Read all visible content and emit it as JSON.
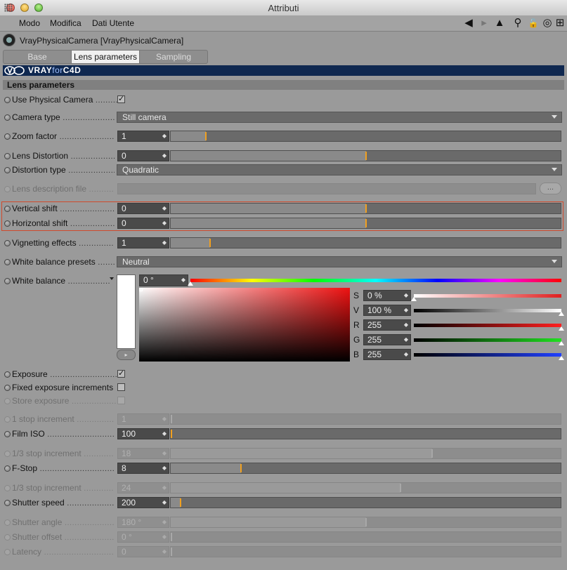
{
  "window": {
    "title": "Attributi"
  },
  "menu": {
    "items": [
      "Modo",
      "Modifica",
      "Dati Utente"
    ]
  },
  "toolbar": {
    "icons": [
      "arrow-left-icon",
      "arrow-right-icon",
      "arrow-up-icon",
      "search-icon",
      "lock-icon",
      "target-icon",
      "add-icon"
    ],
    "glyphs": [
      "◀",
      "▸",
      "▲",
      "⚲",
      "🔓",
      "◎",
      "⊞"
    ]
  },
  "object": {
    "title": "VrayPhysicalCamera [VrayPhysicalCamera]"
  },
  "tabs": [
    {
      "label": "Base",
      "active": false
    },
    {
      "label": "Lens parameters",
      "active": true
    },
    {
      "label": "Sampling",
      "active": false
    }
  ],
  "banner": {
    "brand": "VRAY",
    "brand_for": "for",
    "brand_c4d": "C4D"
  },
  "section": {
    "title": "Lens parameters"
  },
  "rows": {
    "use_physical_camera": {
      "label": "Use Physical Camera",
      "checked": true
    },
    "camera_type": {
      "label": "Camera type",
      "value": "Still camera"
    },
    "zoom_factor": {
      "label": "Zoom factor",
      "value": "1",
      "level": 0.09
    },
    "lens_distortion": {
      "label": "Lens Distortion",
      "value": "0",
      "level": 0.5
    },
    "distortion_type": {
      "label": "Distortion type",
      "value": "Quadratic"
    },
    "lens_description_file": {
      "label": "Lens description file",
      "button": "..."
    },
    "vertical_shift": {
      "label": "Vertical shift",
      "value": "0",
      "level": 0.5
    },
    "horizontal_shift": {
      "label": "Horizontal shift",
      "value": "0",
      "level": 0.5
    },
    "vignetting_effects": {
      "label": "Vignetting effects",
      "value": "1",
      "level": 0.1
    },
    "white_balance_presets": {
      "label": "White balance presets",
      "value": "Neutral"
    },
    "white_balance": {
      "label": "White balance"
    },
    "exposure": {
      "label": "Exposure",
      "checked": true
    },
    "fixed_exposure_increments": {
      "label": "Fixed exposure increments",
      "checked": false
    },
    "store_exposure": {
      "label": "Store exposure",
      "checked": false
    },
    "stop_increment_1": {
      "label": "1 stop increment",
      "value": "1",
      "level": 0.0
    },
    "film_iso": {
      "label": "Film ISO",
      "value": "100",
      "level": 0.0
    },
    "third_stop_increment_a": {
      "label": "1/3 stop increment",
      "value": "18",
      "level": 0.67
    },
    "f_stop": {
      "label": "F-Stop",
      "value": "8",
      "level": 0.18
    },
    "third_stop_increment_b": {
      "label": "1/3 stop increment",
      "value": "24",
      "level": 0.59
    },
    "shutter_speed": {
      "label": "Shutter speed",
      "value": "200",
      "level": 0.025
    },
    "shutter_angle": {
      "label": "Shutter angle",
      "value": "180 °",
      "level": 0.5
    },
    "shutter_offset": {
      "label": "Shutter offset",
      "value": "0 °",
      "level": 0.0
    },
    "latency": {
      "label": "Latency",
      "value": "0",
      "level": 0.0
    }
  },
  "color": {
    "hue_value": "0 °",
    "hue_level": 0.0,
    "channels": [
      {
        "key": "S",
        "value": "0 %",
        "level": 0.0,
        "from": "#ffffff",
        "to": "#e02020"
      },
      {
        "key": "V",
        "value": "100 %",
        "level": 1.0,
        "from": "#000000",
        "to": "#ffffff"
      },
      {
        "key": "R",
        "value": "255",
        "level": 1.0,
        "from": "#000000",
        "to": "#ff2020"
      },
      {
        "key": "G",
        "value": "255",
        "level": 1.0,
        "from": "#000000",
        "to": "#20e020"
      },
      {
        "key": "B",
        "value": "255",
        "level": 1.0,
        "from": "#000000",
        "to": "#2040ff"
      }
    ],
    "swatch_color": "#ffffff",
    "accent": "#f0a020",
    "highlight_border": "#d04a2c"
  }
}
